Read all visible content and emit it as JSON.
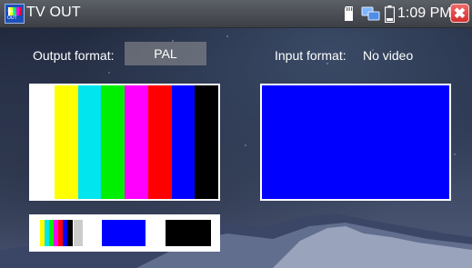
{
  "titlebar": {
    "title": "TV OUT",
    "time": "1:09 PM",
    "icons": [
      "sd-card-icon",
      "network-icon",
      "battery-icon",
      "close-icon"
    ]
  },
  "output": {
    "label": "Output format:",
    "value": "PAL"
  },
  "input": {
    "label": "Input format:",
    "value": "No video"
  },
  "colors": {
    "color_bars": [
      "#ffffff",
      "#ffff00",
      "#00e5ee",
      "#00ee00",
      "#ff00ff",
      "#ff0000",
      "#0000ff",
      "#000000"
    ],
    "input_no_signal": "#0000fe",
    "close_button": "#d42e2e"
  }
}
